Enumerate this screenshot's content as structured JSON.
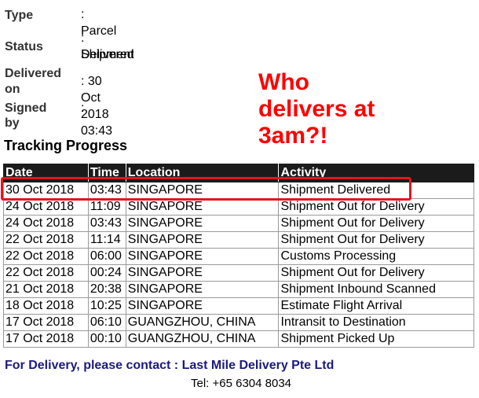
{
  "shipment": {
    "type_label": "Type",
    "type_value": ": Parcel",
    "status_label": "Status",
    "status_value_line1": ": Shipment",
    "status_value_line2": "Delivered",
    "delivered_label_line1": "Delivered",
    "delivered_label_line2": "on",
    "delivered_value": ": 30 Oct 2018 03:43",
    "signed_label": "Signed by",
    "signed_value": ":"
  },
  "annotation": {
    "text": "Who\ndelivers at\n3am?!",
    "color": "#ff0000"
  },
  "tracking": {
    "title": "Tracking Progress",
    "columns": [
      "Date",
      "Time",
      "Location",
      "Activity"
    ],
    "rows": [
      [
        "30 Oct 2018",
        "03:43",
        "SINGAPORE",
        "Shipment Delivered"
      ],
      [
        "24 Oct 2018",
        "11:09",
        "SINGAPORE",
        "Shipment Out for Delivery"
      ],
      [
        "24 Oct 2018",
        "03:43",
        "SINGAPORE",
        "Shipment Out for Delivery"
      ],
      [
        "22 Oct 2018",
        "11:14",
        "SINGAPORE",
        "Shipment Out for Delivery"
      ],
      [
        "22 Oct 2018",
        "06:00",
        "SINGAPORE",
        "Customs Processing"
      ],
      [
        "22 Oct 2018",
        "00:24",
        "SINGAPORE",
        "Shipment Out for Delivery"
      ],
      [
        "21 Oct 2018",
        "20:38",
        "SINGAPORE",
        "Shipment Inbound Scanned"
      ],
      [
        "18 Oct 2018",
        "10:25",
        "SINGAPORE",
        "Estimate Flight Arrival"
      ],
      [
        "17 Oct 2018",
        "06:10",
        "GUANGZHOU, CHINA",
        "Intransit to Destination"
      ],
      [
        "17 Oct 2018",
        "00:10",
        "GUANGZHOU, CHINA",
        "Shipment Picked Up"
      ]
    ]
  },
  "contact": {
    "text": "For Delivery, please contact : Last Mile Delivery Pte Ltd",
    "tel": "Tel: +65 6304 8034",
    "color": "#1a1a80"
  },
  "highlight_color": "#e2161e"
}
